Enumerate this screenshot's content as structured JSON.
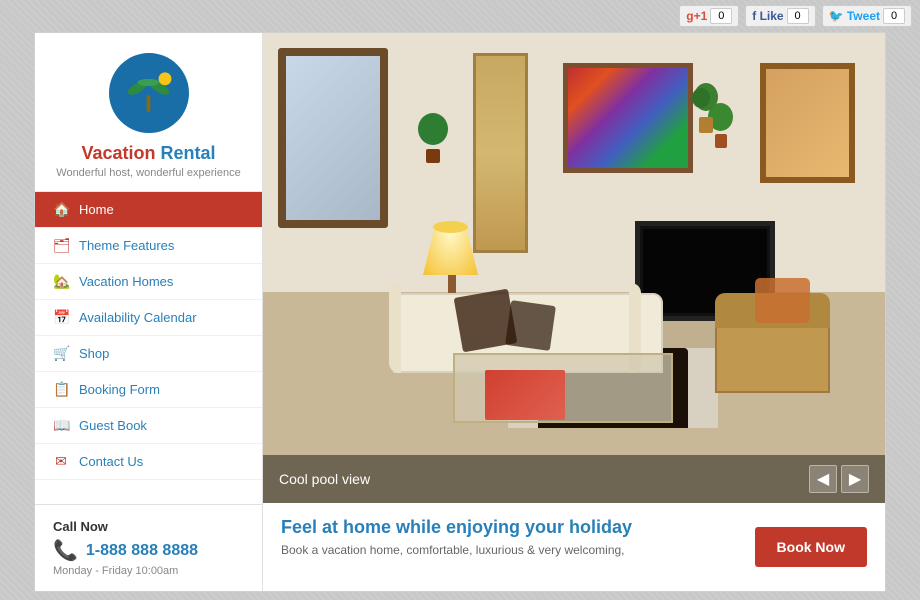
{
  "social": {
    "gplus_label": "+1",
    "gplus_count": "0",
    "fb_label": "Like",
    "fb_count": "0",
    "tw_label": "Tweet",
    "tw_count": "0"
  },
  "sidebar": {
    "logo_alt": "Vacation Rental Logo",
    "title_vacation": "Vacation",
    "title_rental": "Rental",
    "subtitle": "Wonderful host, wonderful experience",
    "nav_items": [
      {
        "label": "Home",
        "icon": "🏠",
        "active": true
      },
      {
        "label": "Theme Features",
        "icon": "🗂",
        "active": false
      },
      {
        "label": "Vacation Homes",
        "icon": "🏡",
        "active": false
      },
      {
        "label": "Availability Calendar",
        "icon": "📅",
        "active": false
      },
      {
        "label": "Shop",
        "icon": "🛒",
        "active": false
      },
      {
        "label": "Booking Form",
        "icon": "📋",
        "active": false
      },
      {
        "label": "Guest Book",
        "icon": "📖",
        "active": false
      },
      {
        "label": "Contact Us",
        "icon": "✉",
        "active": false
      }
    ],
    "call_now": "Call Now",
    "phone": "1-888 888 8888",
    "hours": "Monday - Friday 10:00am"
  },
  "hero": {
    "caption": "Cool pool view",
    "prev_arrow": "◀",
    "next_arrow": "▶"
  },
  "content": {
    "heading": "Feel at home while enjoying your holiday",
    "text": "Book a vacation home, comfortable, luxurious & very welcoming,",
    "book_now": "Book Now"
  }
}
